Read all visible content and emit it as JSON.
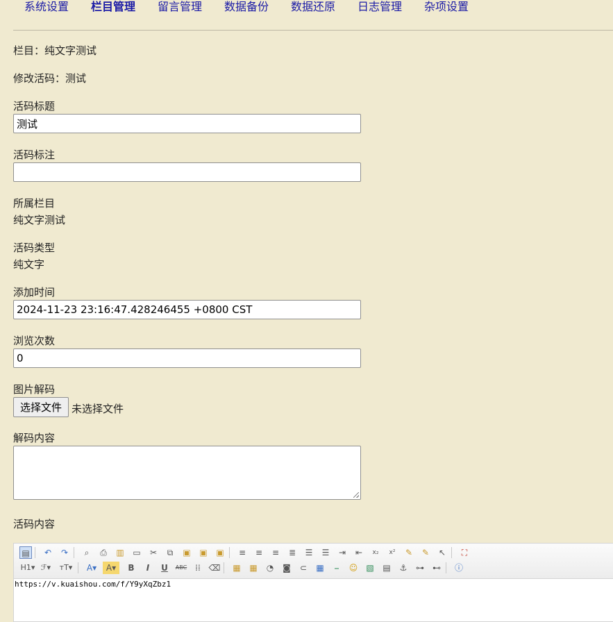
{
  "nav": [
    {
      "label": "系统设置",
      "active": false
    },
    {
      "label": "栏目管理",
      "active": true
    },
    {
      "label": "留言管理",
      "active": false
    },
    {
      "label": "数据备份",
      "active": false
    },
    {
      "label": "数据还原",
      "active": false
    },
    {
      "label": "日志管理",
      "active": false
    },
    {
      "label": "杂项设置",
      "active": false
    }
  ],
  "info": {
    "column_line": "栏目：纯文字测试",
    "edit_line": "修改活码：测试"
  },
  "form": {
    "title_label": "活码标题",
    "title_value": "测试",
    "note_label": "活码标注",
    "note_value": "",
    "column_label": "所属栏目",
    "column_value": "纯文字测试",
    "type_label": "活码类型",
    "type_value": "纯文字",
    "time_label": "添加时间",
    "time_value": "2024-11-23 23:16:47.428246455 +0800 CST",
    "views_label": "浏览次数",
    "views_value": "0",
    "image_label": "图片解码",
    "file_button": "选择文件",
    "file_status": "未选择文件",
    "decode_label": "解码内容",
    "decode_value": "",
    "content_label": "活码内容"
  },
  "editor": {
    "content": "https://v.kuaishou.com/f/Y9yXqZbz1"
  }
}
